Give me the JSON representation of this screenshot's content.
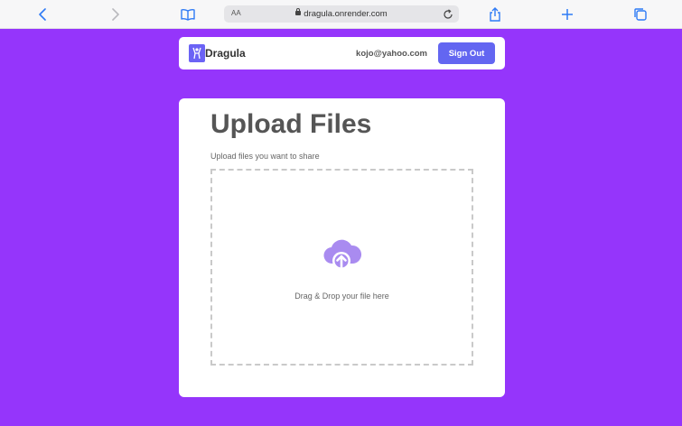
{
  "browser": {
    "text_size_label": "AA",
    "url": "dragula.onrender.com"
  },
  "header": {
    "brand": "Dragula",
    "user_email": "kojo@yahoo.com",
    "sign_out_label": "Sign Out"
  },
  "upload": {
    "title": "Upload Files",
    "subtitle": "Upload files you want to share",
    "drop_text": "Drag & Drop your file here"
  },
  "colors": {
    "background": "#9535fb",
    "accent": "#6366f1",
    "cloud": "#a98bf0",
    "browser_blue": "#2f7bf6"
  },
  "icons": [
    "back-icon",
    "forward-icon",
    "bookmarks-icon",
    "lock-icon",
    "reload-icon",
    "share-icon",
    "new-tab-icon",
    "tabs-icon",
    "logo-icon",
    "cloud-upload-icon"
  ]
}
